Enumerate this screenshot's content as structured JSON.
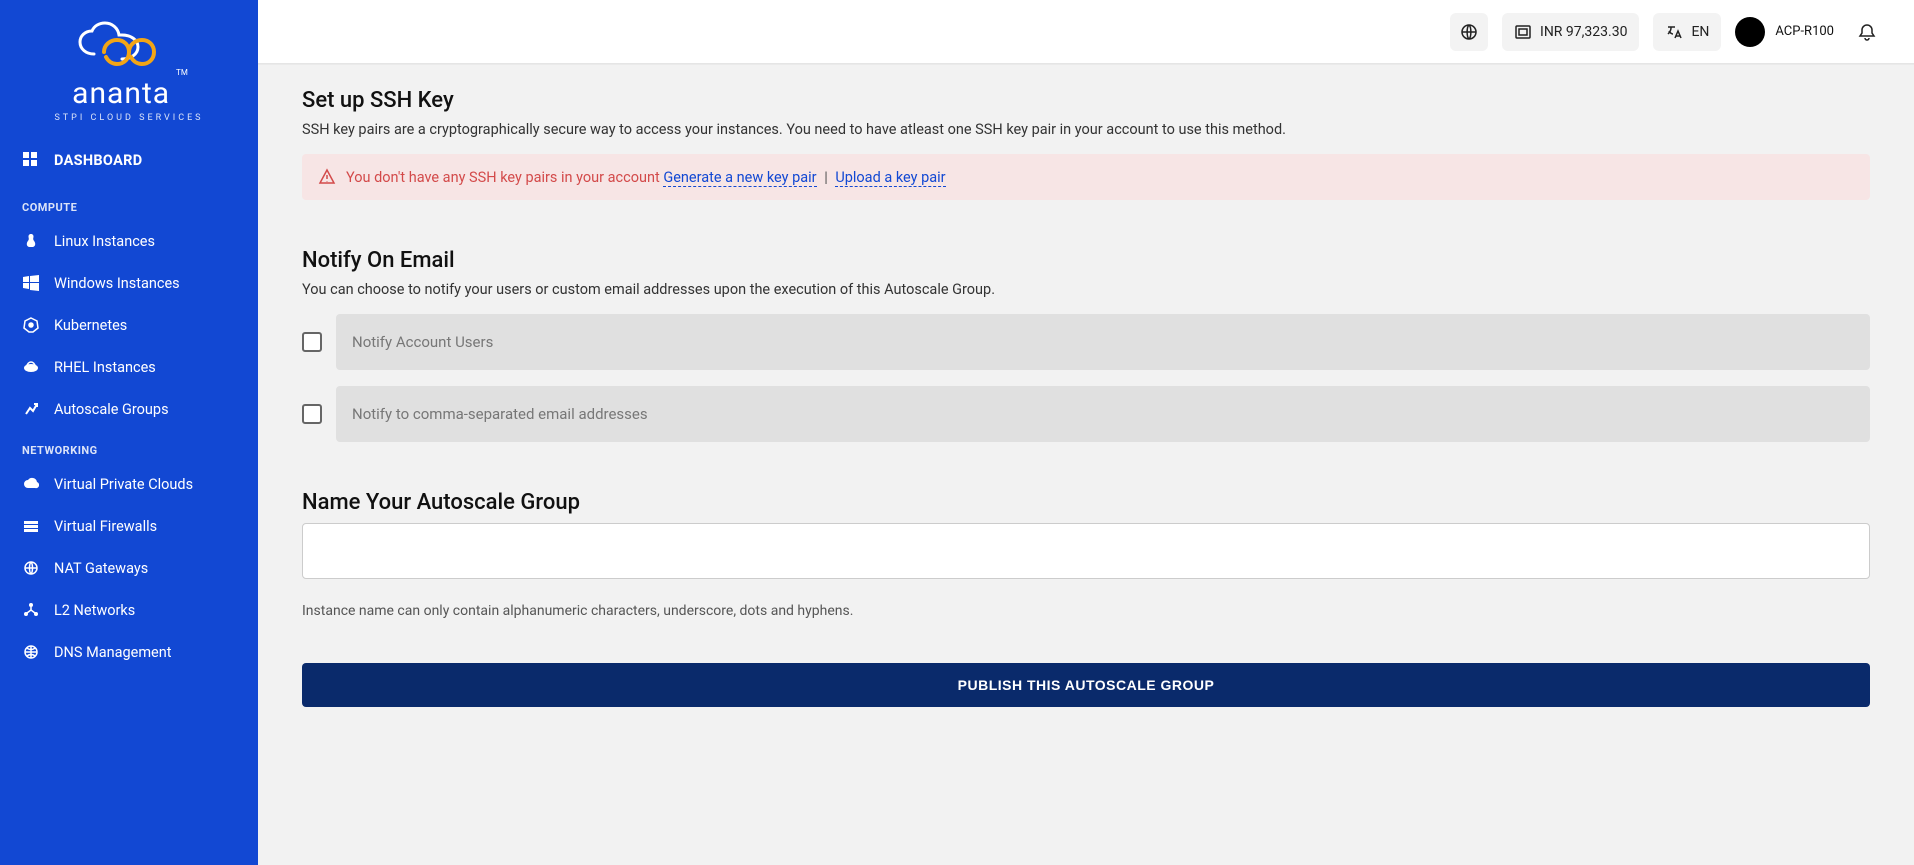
{
  "brand": {
    "name": "ananta",
    "subtitle": "STPI CLOUD SERVICES",
    "tm": "TM"
  },
  "nav": {
    "dashboard": "DASHBOARD",
    "compute_header": "COMPUTE",
    "linux": "Linux Instances",
    "windows": "Windows Instances",
    "kubernetes": "Kubernetes",
    "rhel": "RHEL Instances",
    "autoscale": "Autoscale Groups",
    "networking_header": "NETWORKING",
    "vpc": "Virtual Private Clouds",
    "firewalls": "Virtual Firewalls",
    "nat": "NAT Gateways",
    "l2": "L2 Networks",
    "dns": "DNS Management"
  },
  "topbar": {
    "balance": "INR 97,323.30",
    "lang": "EN",
    "user": "ACP-R100"
  },
  "ssh": {
    "title": "Set up SSH Key",
    "desc": "SSH key pairs are a cryptographically secure way to access your instances. You need to have atleast one SSH key pair in your account to use this method.",
    "alert_text": "You don't have any SSH key pairs in your account",
    "generate_link": "Generate a new key pair",
    "upload_link": "Upload a key pair"
  },
  "notify": {
    "title": "Notify On Email",
    "desc": "You can choose to notify your users or custom email addresses upon the execution of this Autoscale Group.",
    "opt1": "Notify Account Users",
    "opt2": "Notify to comma-separated email addresses"
  },
  "nameblock": {
    "title": "Name Your Autoscale Group",
    "hint": "Instance name can only contain alphanumeric characters, underscore, dots and hyphens."
  },
  "publish_label": "PUBLISH THIS AUTOSCALE GROUP"
}
